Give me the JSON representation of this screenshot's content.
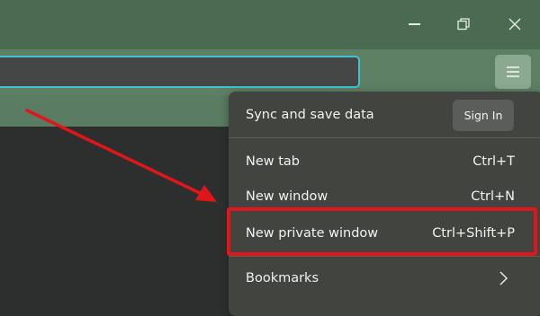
{
  "window_controls": {
    "minimize_icon": "minimize-icon",
    "restore_icon": "restore-icon",
    "close_icon": "close-icon"
  },
  "toolbar": {
    "menu_icon": "hamburger-menu-icon",
    "url_value": ""
  },
  "menu": {
    "sync_label": "Sync and save data",
    "sign_in_label": "Sign In",
    "items": [
      {
        "label": "New tab",
        "shortcut": "Ctrl+T"
      },
      {
        "label": "New window",
        "shortcut": "Ctrl+N"
      },
      {
        "label": "New private window",
        "shortcut": "Ctrl+Shift+P"
      },
      {
        "label": "Bookmarks",
        "shortcut": ""
      }
    ],
    "bookmarks_icon": "chevron-right-icon"
  },
  "annotation": {
    "arrow_color": "#e0161b",
    "highlight_color": "#e0161b"
  },
  "colors": {
    "titlebar": "#4a6a52",
    "toolbar": "#5d8065",
    "url_focus_ring": "#40c2d2",
    "menu_background": "#424440"
  }
}
